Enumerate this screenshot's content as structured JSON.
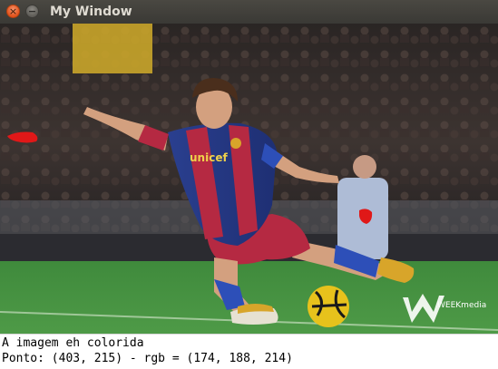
{
  "window": {
    "title": "My Window",
    "close_glyph": "×",
    "minimize_glyph": "−"
  },
  "image": {
    "jersey_text": "unicef",
    "watermark_text": "WEEKmedia",
    "icons": [
      "close-icon",
      "minimize-icon",
      "weekmedia-logo"
    ]
  },
  "status": {
    "line1": "A imagem eh colorida",
    "line2": "Ponto: (403, 215) - rgb = (174, 188, 214)"
  }
}
